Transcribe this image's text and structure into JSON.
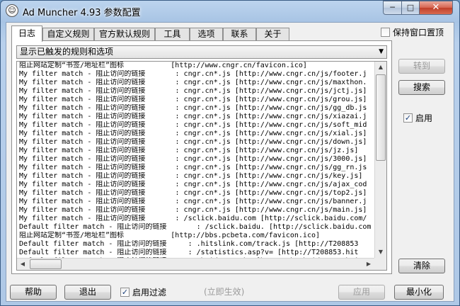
{
  "window": {
    "title": "Ad Muncher 4.93 参数配置",
    "minimize_glyph": "─",
    "maximize_glyph": "□",
    "close_glyph": "✕",
    "app_icon_glyph": "☺"
  },
  "tabs": [
    {
      "label": "日志"
    },
    {
      "label": "自定义规则"
    },
    {
      "label": "官方默认规则"
    },
    {
      "label": "工具"
    },
    {
      "label": "选项"
    },
    {
      "label": "联系"
    },
    {
      "label": "关于"
    }
  ],
  "keep_window": {
    "label": "保持窗口置顶",
    "checked": false
  },
  "log_filter": {
    "selected": "显示已触发的规则和选项"
  },
  "log_lines": [
    "阻止网站定制“书签/地址栏”图标           [http://www.cngr.cn/favicon.ico]",
    "My filter match - 阻止访问的链接       : cngr.cn*.js [http://www.cngr.cn/js/footer.j",
    "My filter match - 阻止访问的链接       : cngr.cn*.js [http://www.cngr.cn/js/maxthon.",
    "My filter match - 阻止访问的链接       : cngr.cn*.js [http://www.cngr.cn/js/jctj.js]",
    "My filter match - 阻止访问的链接       : cngr.cn*.js [http://www.cngr.cn/js/grou.js]",
    "My filter match - 阻止访问的链接       : cngr.cn*.js [http://www.cngr.cn/js/gg_db.js",
    "My filter match - 阻止访问的链接       : cngr.cn*.js [http://www.cngr.cn/js/xiazai.j",
    "My filter match - 阻止访问的链接       : cngr.cn*.js [http://www.cngr.cn/js/soft_mid",
    "My filter match - 阻止访问的链接       : cngr.cn*.js [http://www.cngr.cn/js/xial.js]",
    "My filter match - 阻止访问的链接       : cngr.cn*.js [http://www.cngr.cn/js/down.js]",
    "My filter match - 阻止访问的链接       : cngr.cn*.js [http://www.cngr.cn/js/jz.js]",
    "My filter match - 阻止访问的链接       : cngr.cn*.js [http://www.cngr.cn/js/3000.js]",
    "My filter match - 阻止访问的链接       : cngr.cn*.js [http://www.cngr.cn/js/gg_rn.js",
    "My filter match - 阻止访问的链接       : cngr.cn*.js [http://www.cngr.cn/js/key.js]",
    "My filter match - 阻止访问的链接       : cngr.cn*.js [http://www.cngr.cn/js/ajax_cod",
    "My filter match - 阻止访问的链接       : cngr.cn*.js [http://www.cngr.cn/js/top2.js]",
    "My filter match - 阻止访问的链接       : cngr.cn*.js [http://www.cngr.cn/js/banner.j",
    "My filter match - 阻止访问的链接       : cngr.cn*.js [http://www.cngr.cn/js/main.js]",
    "My filter match - 阻止访问的链接       : /sclick.baidu.com [http://sclick.baidu.com/",
    "Default filter match - 阻止访问的链接       : /sclick.baidu. [http://sclick.baidu.com",
    "阻止网站定制“书签/地址栏”图标           [http://bbs.pcbeta.com/favicon.ico]",
    "Default filter match - 阻止访问的链接     : .hitslink.com/track.js [http://T208853",
    "Default filter match - 阻止访问的链接     : /statistics.asp?v= [http://T208853.hit",
    "Default filter match - 阻止访问的链接     : .baidu.com/h. [http://hm.baidu.com/h.j"
  ],
  "scroll": {
    "up": "▲",
    "down": "▼",
    "left": "◀",
    "right": "▶"
  },
  "side": {
    "goto_label": "转到",
    "search_label": "搜索",
    "enabled_label": "启用",
    "enabled_checked": true,
    "clear_label": "清除"
  },
  "footer": {
    "help_label": "帮助",
    "exit_label": "退出",
    "enable_filter_label": "启用过滤",
    "enable_filter_checked": true,
    "apply_now_label": "(立即生效)",
    "apply_label": "应用",
    "minimize_label": "最小化"
  },
  "check_glyph": "✓",
  "dropdown_arrow": "▼"
}
